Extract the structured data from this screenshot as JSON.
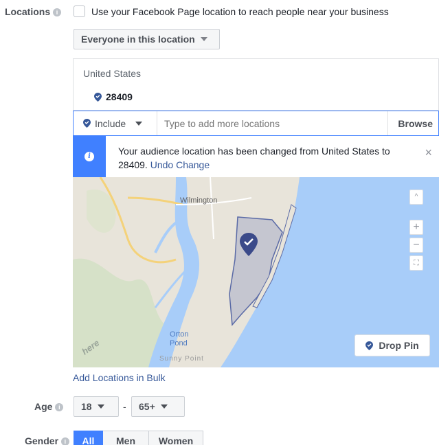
{
  "locations": {
    "label": "Locations",
    "page_location_text": "Use your Facebook Page location to reach people near your business",
    "audience_dropdown": "Everyone in this location",
    "country": "United States",
    "selected_location": "28409",
    "include_label": "Include",
    "search_placeholder": "Type to add more locations",
    "browse_label": "Browse",
    "notice": {
      "text": "Your audience location has been changed from United States to 28409.",
      "undo_label": "Undo Change"
    },
    "map": {
      "place_labels": [
        "Wilmington",
        "Orton",
        "Pond",
        "Sunny Point"
      ],
      "watermark": "here",
      "drop_pin_label": "Drop Pin",
      "colors": {
        "water": "#a8cdf9",
        "land": "#e8e4da",
        "selection": "#b9bccc",
        "pin": "#3b4a8a"
      }
    },
    "bulk_link": "Add Locations in Bulk"
  },
  "age": {
    "label": "Age",
    "min": "18",
    "separator": "-",
    "max": "65+"
  },
  "gender": {
    "label": "Gender",
    "options": [
      "All",
      "Men",
      "Women"
    ],
    "selected": "All"
  },
  "colors": {
    "accent": "#4080ff",
    "link": "#365899",
    "text": "#1d2129"
  }
}
